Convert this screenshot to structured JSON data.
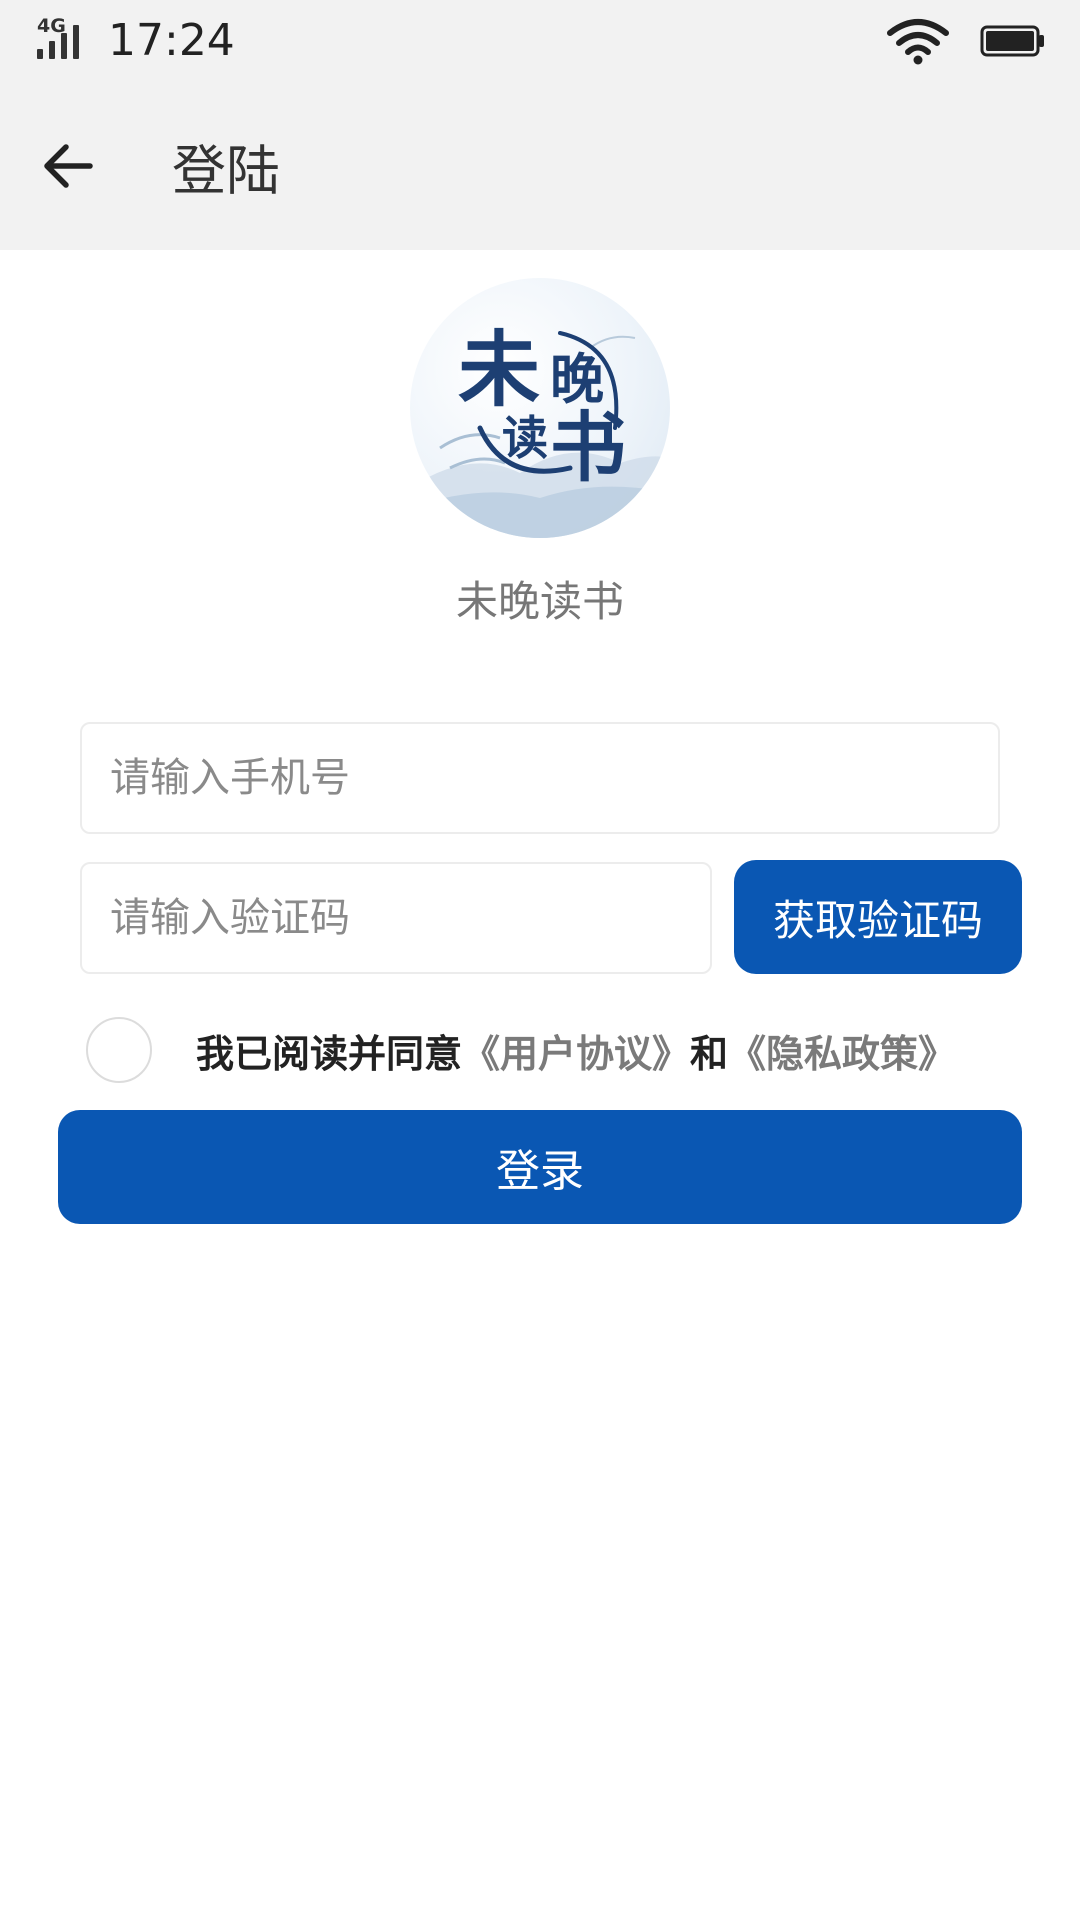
{
  "status_bar": {
    "network": "4G",
    "time": "17:24",
    "icons": [
      "signal-icon",
      "wifi-icon",
      "battery-icon"
    ]
  },
  "header": {
    "back_icon": "arrow-left-icon",
    "title": "登陆"
  },
  "logo": {
    "text_chars": [
      "未",
      "晚",
      "读",
      "书"
    ]
  },
  "app_name": "未晚读书",
  "form": {
    "phone_value": "",
    "phone_placeholder": "请输入手机号",
    "code_value": "",
    "code_placeholder": "请输入验证码",
    "get_code_label": "获取验证码"
  },
  "agreement": {
    "checked": false,
    "prefix": "我已阅读并同意",
    "user_agreement": "《用户协议》",
    "conjunction": "和",
    "privacy_policy": "《隐私政策》"
  },
  "login_label": "登录",
  "colors": {
    "primary": "#0a57b3",
    "bar_background": "#f2f2f2",
    "link_gray": "#7a7a7a",
    "logo_ink": "#1d3f73"
  }
}
